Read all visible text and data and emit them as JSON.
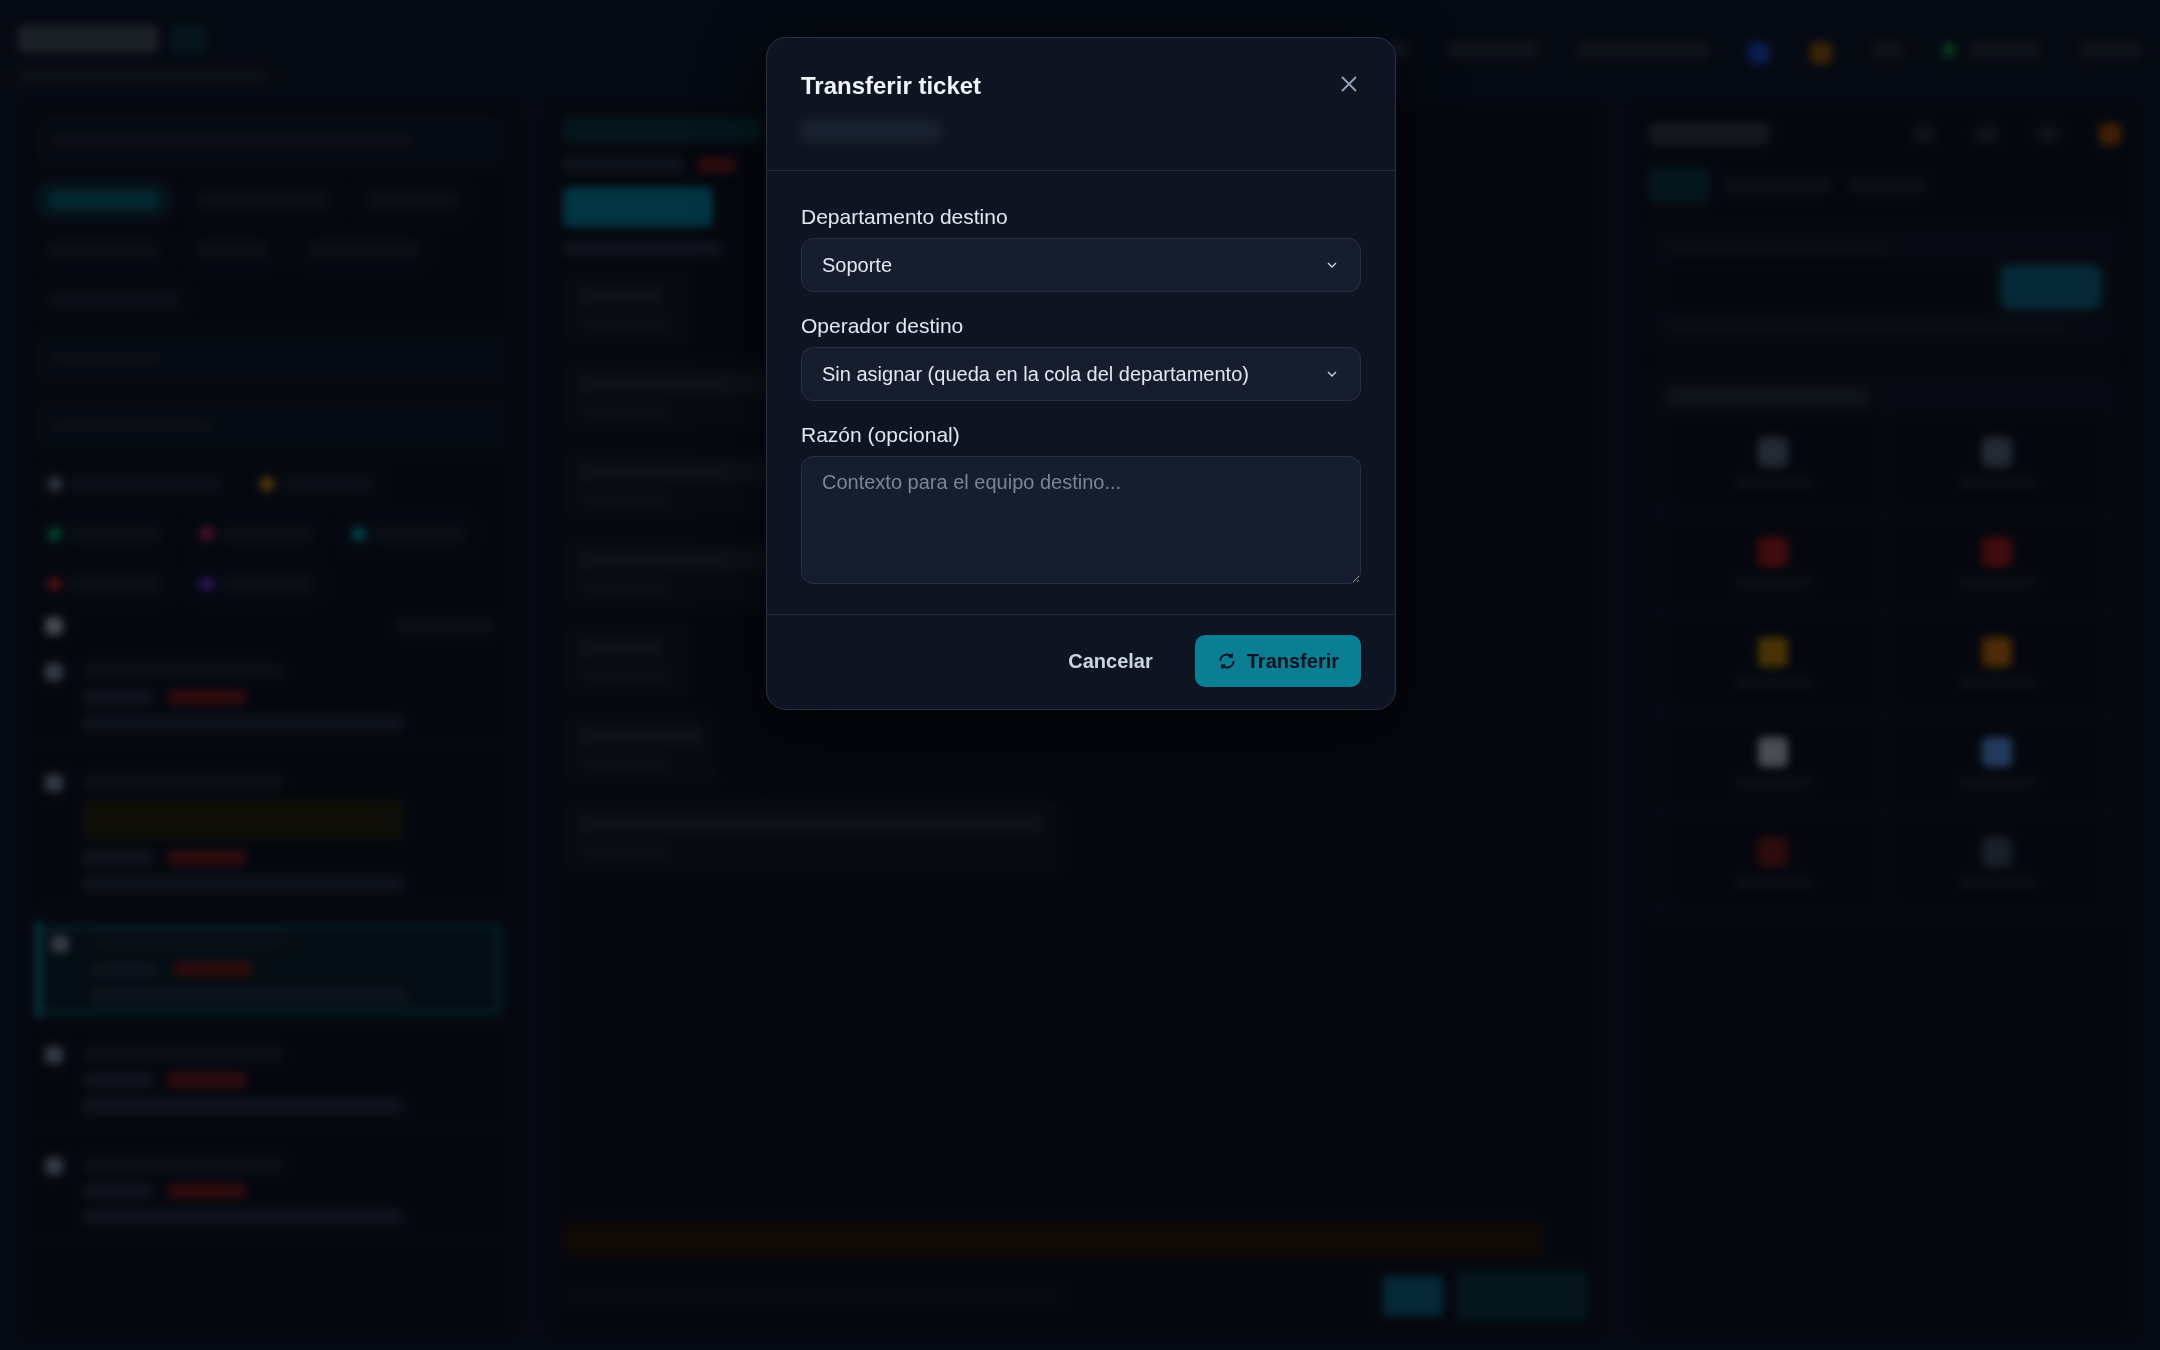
{
  "dialog": {
    "title": "Transferir ticket",
    "fields": [
      {
        "kind": "select",
        "label": "Departamento destino",
        "value": "Soporte"
      },
      {
        "kind": "select",
        "label": "Operador destino",
        "value": "Sin asignar (queda en la cola del departamento)"
      },
      {
        "kind": "textarea",
        "label": "Razón (opcional)",
        "placeholder": "Contexto para el equipo destino..."
      }
    ],
    "cancel": "Cancelar",
    "confirm": "Transferir"
  }
}
